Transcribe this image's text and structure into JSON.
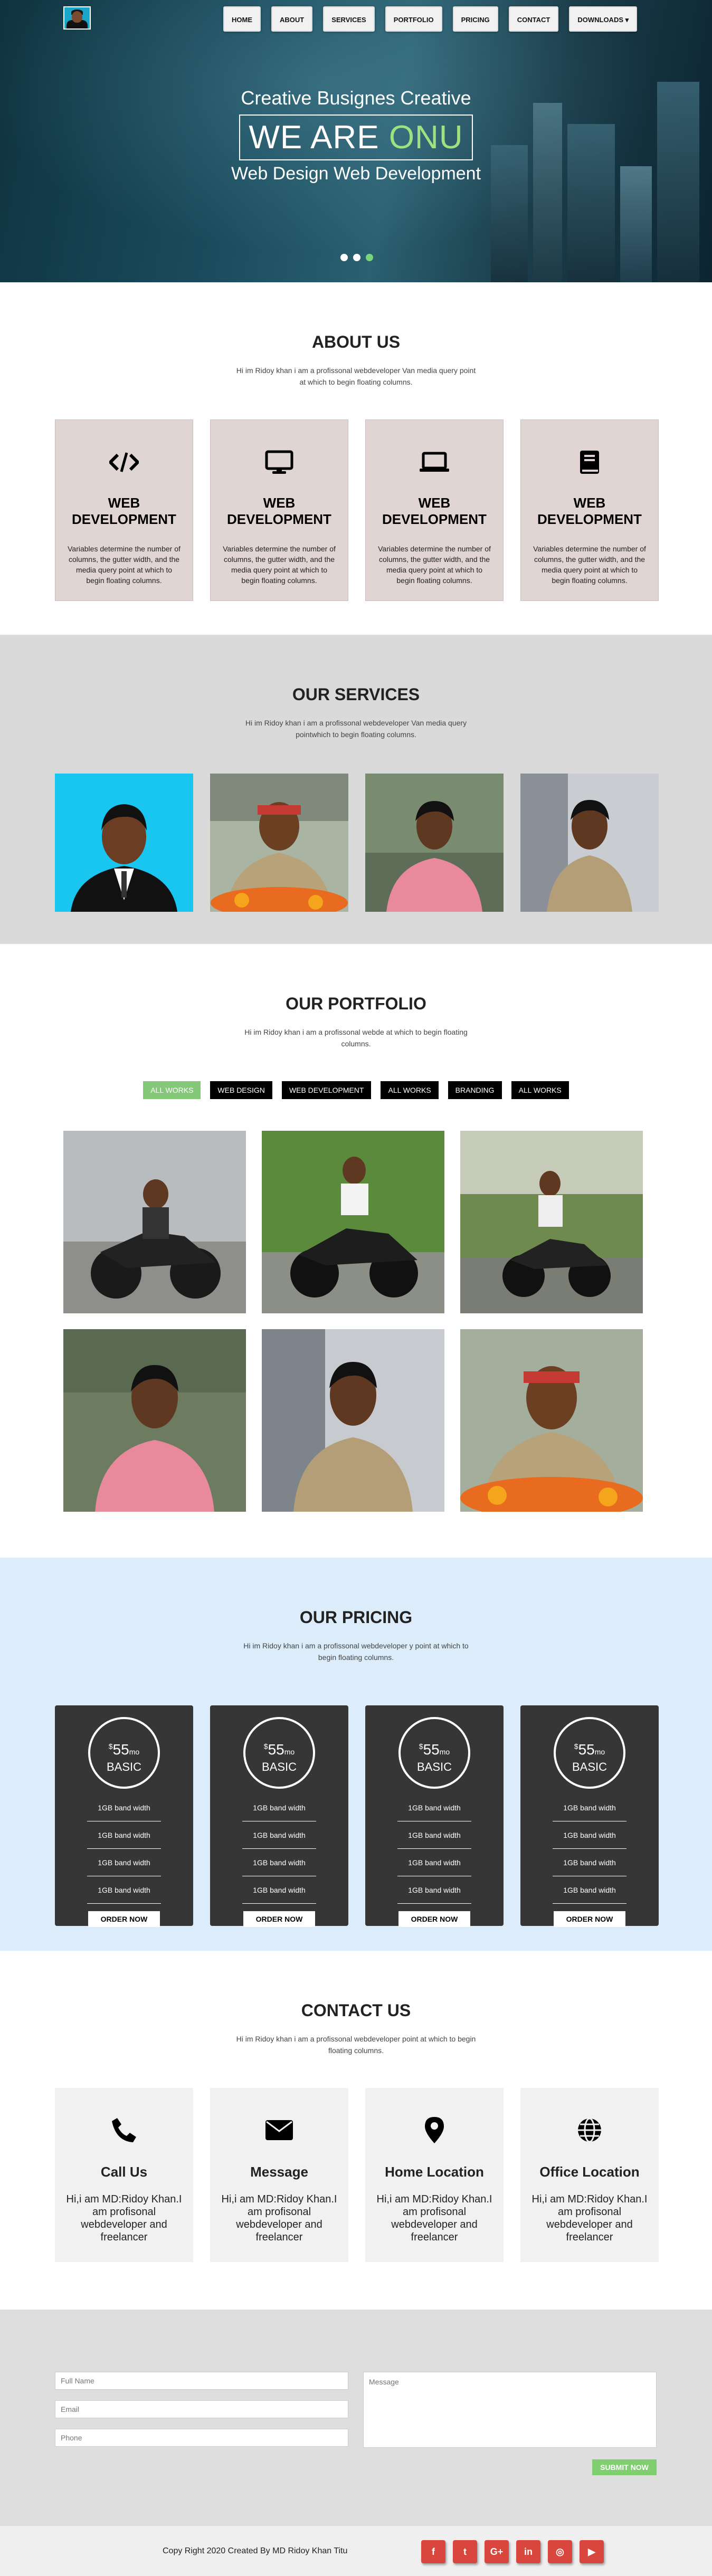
{
  "nav": {
    "items": [
      "HOME",
      "ABOUT",
      "SERVICES",
      "PORTFOLIO",
      "PRICING",
      "CONTACT",
      "DOWNLOADS ▾"
    ]
  },
  "hero": {
    "subtitle": "Creative Busignes Creative",
    "headline_prefix": "WE ARE",
    "headline_highlight": "ONU",
    "tagline": "Web Design Web Development",
    "highlight_color": "#9ee27f",
    "slides": 3,
    "active_slide": 3
  },
  "about": {
    "title": "ABOUT US",
    "description": "Hi im Ridoy khan i am a profissonal webdeveloper Van media query point at which to begin floating columns.",
    "cards": [
      {
        "icon": "code-icon",
        "title": "WEB DEVELOPMENT",
        "text": "Variables determine the number of columns, the gutter width, and the media query point at which to begin floating columns."
      },
      {
        "icon": "desktop-icon",
        "title": "WEB DEVELOPMENT",
        "text": "Variables determine the number of columns, the gutter width, and the media query point at which to begin floating columns."
      },
      {
        "icon": "laptop-icon",
        "title": "WEB DEVELOPMENT",
        "text": "Variables determine the number of columns, the gutter width, and the media query point at which to begin floating columns."
      },
      {
        "icon": "book-icon",
        "title": "WEB DEVELOPMENT",
        "text": "Variables determine the number of columns, the gutter width, and the media query point at which to begin floating columns."
      }
    ]
  },
  "services": {
    "title": "OUR SERVICES",
    "description": "Hi im Ridoy khan i am a profissonal webdeveloper Van media query pointwhich to begin floating columns."
  },
  "portfolio": {
    "title": "OUR PORTFOLIO",
    "description": "Hi im Ridoy khan i am a profissonal webde at which to begin floating columns.",
    "filters": [
      "ALL WORKS",
      "WEB DESIGN",
      "WEB DEVELOPMENT",
      "ALL WORKS",
      "BRANDING",
      "ALL WORKS"
    ],
    "active_filter": 0,
    "accent_color": "#86c87a"
  },
  "pricing": {
    "title": "OUR PRICING",
    "description": "Hi im Ridoy khan i am a profissonal webdeveloper y point at which to begin floating columns.",
    "plans": [
      {
        "currency": "$",
        "amount": "55",
        "period": "mo",
        "name": "BASIC",
        "features": [
          "1GB band width",
          "1GB band width",
          "1GB band width",
          "1GB band width"
        ],
        "button": "ORDER NOW"
      },
      {
        "currency": "$",
        "amount": "55",
        "period": "mo",
        "name": "BASIC",
        "features": [
          "1GB band width",
          "1GB band width",
          "1GB band width",
          "1GB band width"
        ],
        "button": "ORDER NOW"
      },
      {
        "currency": "$",
        "amount": "55",
        "period": "mo",
        "name": "BASIC",
        "features": [
          "1GB band width",
          "1GB band width",
          "1GB band width",
          "1GB band width"
        ],
        "button": "ORDER NOW"
      },
      {
        "currency": "$",
        "amount": "55",
        "period": "mo",
        "name": "BASIC",
        "features": [
          "1GB band width",
          "1GB band width",
          "1GB band width",
          "1GB band width"
        ],
        "button": "ORDER NOW"
      }
    ]
  },
  "contact": {
    "title": "CONTACT US",
    "description": "Hi im Ridoy khan i am a profissonal webdeveloper point at which to begin floating columns.",
    "cards": [
      {
        "icon": "phone-icon",
        "title": "Call Us",
        "text": "Hi,i am MD:Ridoy Khan.I am profisonal webdeveloper and freelancer"
      },
      {
        "icon": "envelope-icon",
        "title": "Message",
        "text": "Hi,i am MD:Ridoy Khan.I am profisonal webdeveloper and freelancer"
      },
      {
        "icon": "map-marker-icon",
        "title": "Home Location",
        "text": "Hi,i am MD:Ridoy Khan.I am profisonal webdeveloper and freelancer"
      },
      {
        "icon": "globe-icon",
        "title": "Office Location",
        "text": "Hi,i am MD:Ridoy Khan.I am profisonal webdeveloper and freelancer"
      }
    ]
  },
  "form": {
    "name_placeholder": "Full Name",
    "email_placeholder": "Email",
    "phone_placeholder": "Phone",
    "message_placeholder": "Message",
    "submit": "SUBMIT NOW"
  },
  "footer": {
    "copyright": "Copy Right 2020 Created By MD Ridoy Khan Titu",
    "socials": [
      {
        "icon": "facebook-icon",
        "glyph": "f"
      },
      {
        "icon": "twitter-icon",
        "glyph": "t"
      },
      {
        "icon": "google-plus-icon",
        "glyph": "G+"
      },
      {
        "icon": "linkedin-icon",
        "glyph": "in"
      },
      {
        "icon": "instagram-icon",
        "glyph": "◎"
      },
      {
        "icon": "youtube-icon",
        "glyph": "▶"
      }
    ],
    "social_color": "#d9463e"
  }
}
